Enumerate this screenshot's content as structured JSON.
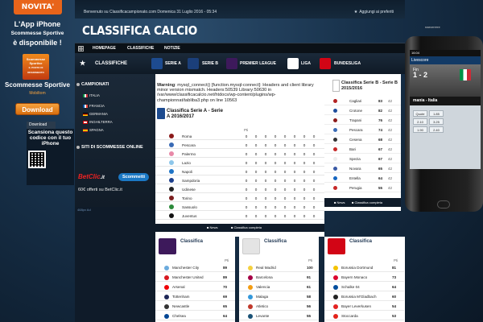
{
  "left_ad": {
    "badge": "NOVITA'",
    "line1": "L'App iPhone",
    "line2": "Scommesse Sportive",
    "line3": "è disponibile !",
    "logo_text": "Scommesse Sportive",
    "logo_sub": "IL PUNTO DI RIFERIMENTO",
    "app_title": "Scommesse Sportive",
    "developer": "Mobiltom",
    "download_label": "Download",
    "tab_label": "Download",
    "scan_text": "Scansiona questo codice con il tuo iPhone"
  },
  "topbar": {
    "welcome": "Benvenuto su Classificacampionato.com    Domenica 31 Luglio 2016 - 05:34",
    "favorites": "Aggiungi ai preferiti"
  },
  "header": {
    "title": "CLASSIFICA CALCIO"
  },
  "nav": {
    "homepage": "HOMEPAGE",
    "classifiche": "CLASSIFICHE",
    "notizie": "NOTIZIE"
  },
  "leagues": {
    "title": "CLASSIFICHE",
    "items": [
      "SERIE A",
      "SERIE B",
      "PREMIER LEAGUE",
      "LIGA",
      "BUNDESLIGA"
    ]
  },
  "sidebar": {
    "campionati_title": "CAMPIONATI",
    "countries": [
      "ITALIA",
      "FRANCIA",
      "GERMANIA",
      "INGHILTERRA",
      "SPAGNA"
    ],
    "siti_title": "SITI DI SCOMMESSE ONLINE",
    "betclic": "BetClic",
    "betclic_suffix": ".it",
    "scommetti": "Scommetti",
    "offer": "60€ offerti su BetClic.it",
    "ad_tab": "468px Ad"
  },
  "main_table": {
    "warning_label": "Warning",
    "warning_text": ": mysql_connect() [function.mysql-connect]: Headers and client library minor version mismatch. Headers:50539 Library:50630 in /var/www/classificacalcio.net/htdocs/wp-content/plugins/wp-championnat/tabliba3.php on line 10563",
    "title": "Classifica Serie A - Serie A 2016/2017",
    "columns": [
      "Pti",
      "",
      "",
      "",
      "",
      "",
      "",
      ""
    ],
    "rows": [
      {
        "team": "Roma",
        "color": "#8b1a1a",
        "vals": [
          "0",
          "0",
          "0",
          "0",
          "0",
          "0",
          "0",
          "0"
        ]
      },
      {
        "team": "Pescara",
        "color": "#3a6bb5",
        "vals": [
          "0",
          "0",
          "0",
          "0",
          "0",
          "0",
          "0",
          "0"
        ]
      },
      {
        "team": "Palermo",
        "color": "#e889a8",
        "vals": [
          "0",
          "0",
          "0",
          "0",
          "0",
          "0",
          "0",
          "0"
        ]
      },
      {
        "team": "Lazio",
        "color": "#8dc6ea",
        "vals": [
          "0",
          "0",
          "0",
          "0",
          "0",
          "0",
          "0",
          "0"
        ]
      },
      {
        "team": "Napoli",
        "color": "#1e74c6",
        "vals": [
          "0",
          "0",
          "0",
          "0",
          "0",
          "0",
          "0",
          "0"
        ]
      },
      {
        "team": "Sampdoria",
        "color": "#1c3f8c",
        "vals": [
          "0",
          "0",
          "0",
          "0",
          "0",
          "0",
          "0",
          "0"
        ]
      },
      {
        "team": "Udinese",
        "color": "#222222",
        "vals": [
          "0",
          "0",
          "0",
          "0",
          "0",
          "0",
          "0",
          "0"
        ]
      },
      {
        "team": "Torino",
        "color": "#7b1e1e",
        "vals": [
          "0",
          "0",
          "0",
          "0",
          "0",
          "0",
          "0",
          "0"
        ]
      },
      {
        "team": "Sassuolo",
        "color": "#2c8a3a",
        "vals": [
          "0",
          "0",
          "0",
          "0",
          "0",
          "0",
          "0",
          "0"
        ]
      },
      {
        "team": "Juventus",
        "color": "#111111",
        "vals": [
          "0",
          "0",
          "0",
          "0",
          "0",
          "0",
          "0",
          "0"
        ]
      }
    ],
    "foot_news": "News",
    "foot_full": "Classifica completa"
  },
  "right_table": {
    "title": "Classifica Serie B - Serie B 2015/2016",
    "rows": [
      {
        "team": "Cagliari",
        "color": "#b22222",
        "pts": "83",
        "pg": "42"
      },
      {
        "team": "Crotone",
        "color": "#1e4d9b",
        "pts": "82",
        "pg": "42"
      },
      {
        "team": "Trapani",
        "color": "#8b1a1a",
        "pts": "76",
        "pg": "42"
      },
      {
        "team": "Pescara",
        "color": "#3a6bb5",
        "pts": "74",
        "pg": "42"
      },
      {
        "team": "Cesena",
        "color": "#333333",
        "pts": "68",
        "pg": "42"
      },
      {
        "team": "Bari",
        "color": "#c62828",
        "pts": "67",
        "pg": "42"
      },
      {
        "team": "Spezia",
        "color": "#eeeeee",
        "pts": "67",
        "pg": "42"
      },
      {
        "team": "Novara",
        "color": "#3b5aa6",
        "pts": "65",
        "pg": "42"
      },
      {
        "team": "Entella",
        "color": "#1565c0",
        "pts": "64",
        "pg": "42"
      },
      {
        "team": "Perugia",
        "color": "#c62828",
        "pts": "55",
        "pg": "42"
      }
    ],
    "foot_news": "News",
    "foot_full": "Classifica completa"
  },
  "cards": [
    {
      "title": "Classifica",
      "col": "Pti",
      "rows": [
        {
          "team": "Manchester City",
          "color": "#6cabdd",
          "pts": "89"
        },
        {
          "team": "Manchester United",
          "color": "#d71920",
          "pts": "89"
        },
        {
          "team": "Arsenal",
          "color": "#ef0107",
          "pts": "70"
        },
        {
          "team": "Tottenham",
          "color": "#1d2757",
          "pts": "69"
        },
        {
          "team": "Newcastle",
          "color": "#333333",
          "pts": "65"
        },
        {
          "team": "Chelsea",
          "color": "#034694",
          "pts": "64"
        }
      ]
    },
    {
      "title": "Classifica",
      "col": "Pti",
      "rows": [
        {
          "team": "Real Madrid",
          "color": "#f4d03f",
          "pts": "100"
        },
        {
          "team": "Barcelona",
          "color": "#a50044",
          "pts": "91"
        },
        {
          "team": "Valencia",
          "color": "#f39c12",
          "pts": "61"
        },
        {
          "team": "Malaga",
          "color": "#3498db",
          "pts": "58"
        },
        {
          "team": "Atletico",
          "color": "#c0392b",
          "pts": "56"
        },
        {
          "team": "Levante",
          "color": "#1a5276",
          "pts": "55"
        }
      ]
    },
    {
      "title": "Classifica",
      "col": "Pti",
      "rows": [
        {
          "team": "Borussia Dortmund",
          "color": "#f4c300",
          "pts": "81"
        },
        {
          "team": "Bayern Monaco",
          "color": "#dc052d",
          "pts": "73"
        },
        {
          "team": "Schalke 04",
          "color": "#004d9d",
          "pts": "64"
        },
        {
          "team": "Borussia M'Gladbach",
          "color": "#222222",
          "pts": "60"
        },
        {
          "team": "Bayer Leverkusen",
          "color": "#e32221",
          "pts": "54"
        },
        {
          "team": "Stoccarda",
          "color": "#e32219",
          "pts": "53"
        }
      ]
    }
  ],
  "phone": {
    "corner_text": "naeorrerre",
    "topbar": "16:04",
    "live": "Livescore",
    "score": "1 - 2",
    "fin": "Fin",
    "match": "mania - Italia",
    "odds": [
      "Quote",
      "1.85",
      "2.10",
      "3.25",
      "1.90",
      "2.40"
    ]
  }
}
